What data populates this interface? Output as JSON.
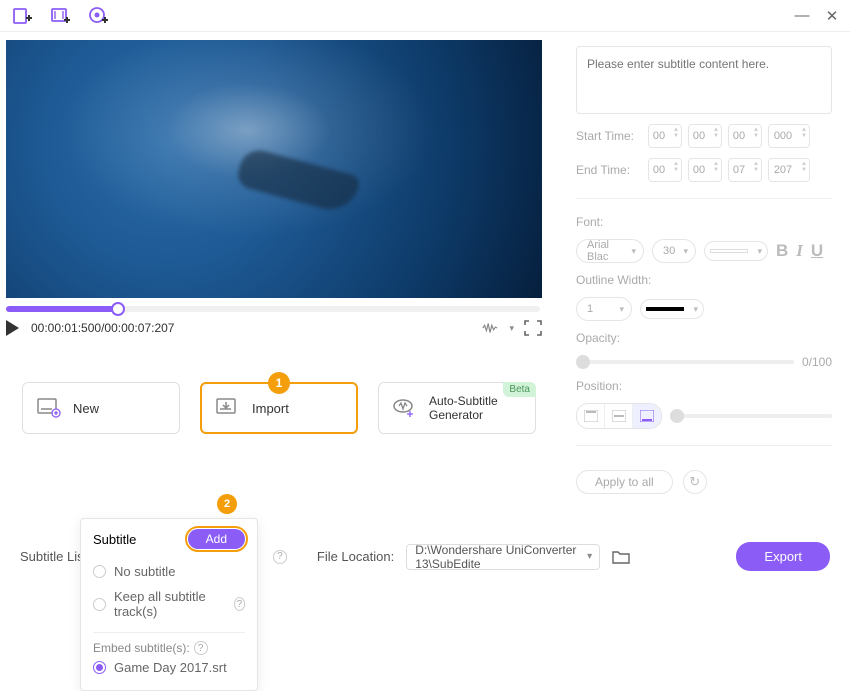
{
  "topbar": {
    "icons": [
      "add-media-icon",
      "add-clip-icon",
      "record-icon"
    ]
  },
  "player": {
    "timecode": "00:00:01:500/00:00:07:207",
    "progress_pct": 21
  },
  "actions": {
    "new_label": "New",
    "import_label": "Import",
    "autosub_label": "Auto-Subtitle Generator",
    "beta_badge": "Beta",
    "step1": "1"
  },
  "subtitle_panel": {
    "placeholder": "Please enter subtitle content here.",
    "start_label": "Start Time:",
    "end_label": "End Time:",
    "start": [
      "00",
      "00",
      "00",
      "000"
    ],
    "end": [
      "00",
      "00",
      "07",
      "207"
    ],
    "font_label": "Font:",
    "font_name": "Arial Blac",
    "font_size": "30",
    "outline_label": "Outline Width:",
    "outline_val": "1",
    "opacity_label": "Opacity:",
    "opacity_val": "0/100",
    "position_label": "Position:",
    "apply_label": "Apply to all"
  },
  "bottom": {
    "sublist_label": "Subtitle List:",
    "sublist_value": "Game Day 2017.srt",
    "fileloc_label": "File Location:",
    "fileloc_value": "D:\\Wondershare UniConverter 13\\SubEdite",
    "export_label": "Export"
  },
  "popup": {
    "title": "Subtitle",
    "add_label": "Add",
    "step2": "2",
    "opt_none": "No subtitle",
    "opt_keep": "Keep all subtitle track(s)",
    "embed_label": "Embed subtitle(s):",
    "embed_item": "Game Day 2017.srt"
  }
}
